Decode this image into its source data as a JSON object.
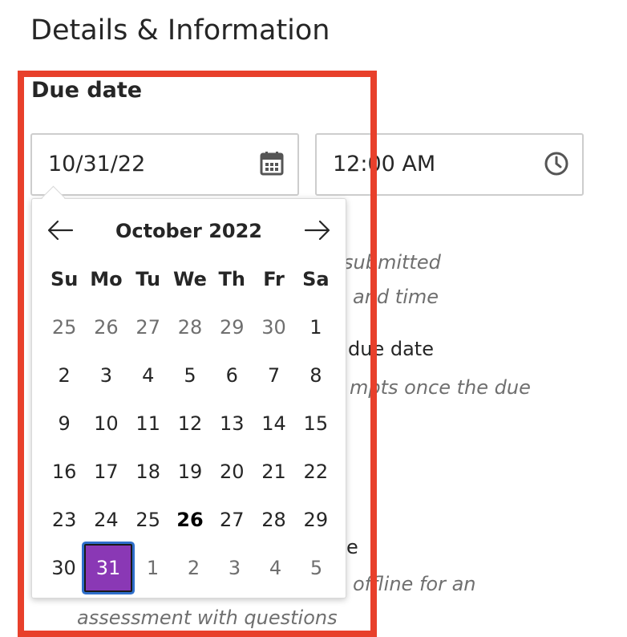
{
  "section_title": "Details & Information",
  "due_date": {
    "label": "Due date",
    "date_value": "10/31/22",
    "time_value": "12:00 AM"
  },
  "background_text": {
    "line1": "submitted",
    "line2": "and time",
    "line3": "due date",
    "line4": "mpts once the due",
    "line5": "e",
    "line6": "offline for an",
    "line7": "assessment with questions"
  },
  "calendar": {
    "month_label": "October 2022",
    "weekdays": [
      "Su",
      "Mo",
      "Tu",
      "We",
      "Th",
      "Fr",
      "Sa"
    ],
    "weeks": [
      [
        "25",
        "26",
        "27",
        "28",
        "29",
        "30",
        "1"
      ],
      [
        "2",
        "3",
        "4",
        "5",
        "6",
        "7",
        "8"
      ],
      [
        "9",
        "10",
        "11",
        "12",
        "13",
        "14",
        "15"
      ],
      [
        "16",
        "17",
        "18",
        "19",
        "20",
        "21",
        "22"
      ],
      [
        "23",
        "24",
        "25",
        "26",
        "27",
        "28",
        "29"
      ],
      [
        "30",
        "31",
        "1",
        "2",
        "3",
        "4",
        "5"
      ]
    ],
    "selected": "31",
    "today": "26"
  },
  "colors": {
    "highlight_border": "#e8402b",
    "selected_bg": "#8a38b5",
    "focus_ring": "#2f6fcb"
  }
}
